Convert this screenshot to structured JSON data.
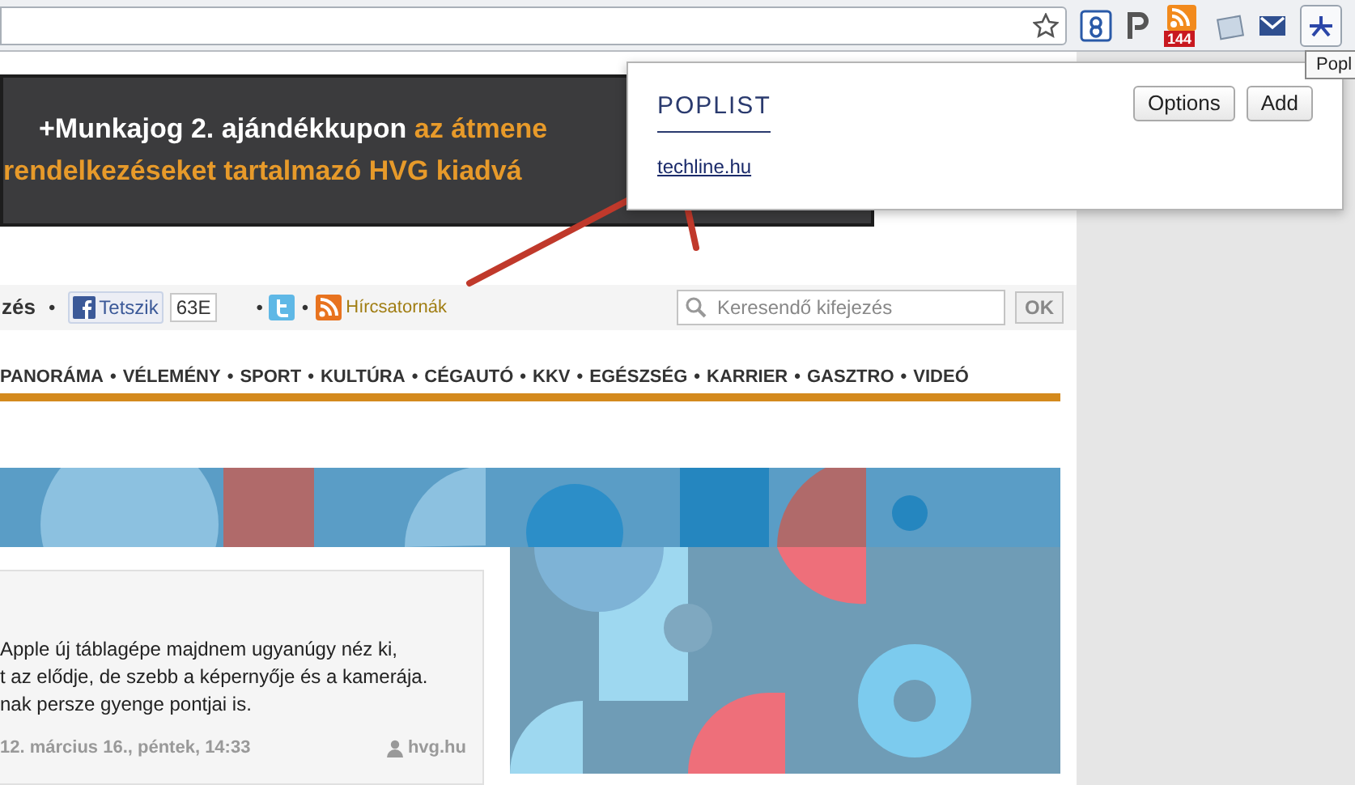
{
  "toolbar": {
    "badge": "144",
    "extension_button_selected": true
  },
  "tooltip": "Popl",
  "banner": {
    "lines": [
      [
        {
          "kind": "plain",
          "text": "+Munkajog 2. ajándékkupon "
        },
        {
          "kind": "accent",
          "text": "az átmene"
        }
      ],
      [
        {
          "kind": "accent",
          "text": "rendelkezéseket tartalmazó HVG kiadvá"
        }
      ]
    ]
  },
  "share_bar": {
    "cut_text": "zés",
    "like_button": "Tetszik",
    "like_count": "63E",
    "feeds_link": "Hírcsatornák",
    "search": {
      "placeholder": "Keresendő kifejezés"
    },
    "search_button": "OK"
  },
  "menu": [
    "PANORÁMA",
    "VÉLEMÉNY",
    "SPORT",
    "KULTÚRA",
    "CÉGAUTÓ",
    "KKV",
    "EGÉSZSÉG",
    "KARRIER",
    "GASZTRO",
    "VIDEÓ"
  ],
  "menu_separator": "•",
  "article": {
    "lines": [
      "Apple új táblagépe majdnem ugyanúgy néz ki,",
      "t az elődje, de szebb a képernyője és a kamerája.",
      "nak persze gyenge pontjai is."
    ],
    "date": "12. március 16., péntek, 14:33",
    "source": "hvg.hu"
  },
  "popup": {
    "title": "POPLIST",
    "buttons": [
      "Options",
      "Add"
    ],
    "links": [
      "techline.hu"
    ]
  }
}
